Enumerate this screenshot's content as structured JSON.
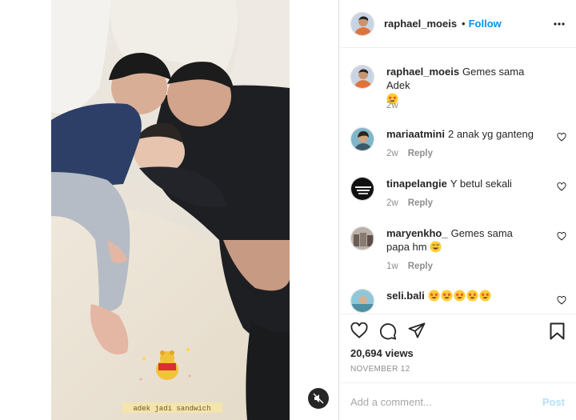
{
  "post": {
    "author": "raphael_moeis",
    "separator": "•",
    "follow_label": "Follow",
    "more_icon": "more-horizontal-icon",
    "caption": {
      "username": "raphael_moeis",
      "text": "Gemes sama Adek",
      "emoji": "star-struck-emoji",
      "time": "2w"
    },
    "comments": [
      {
        "username": "mariaatmini",
        "text": "2 anak yg ganteng",
        "time": "2w",
        "reply_label": "Reply"
      },
      {
        "username": "tinapelangie",
        "text": "Y betul sekali",
        "time": "2w",
        "reply_label": "Reply"
      },
      {
        "username": "maryenkho_",
        "text": "Gemes sama papa hm",
        "emoji": "grinning-sweat-emoji",
        "time": "1w",
        "reply_label": "Reply"
      },
      {
        "username": "seli.bali",
        "emoji_count": 5,
        "emoji": "star-struck-emoji"
      }
    ],
    "views": "20,694 views",
    "date": "NOVEMBER 12",
    "comment_placeholder": "Add a comment...",
    "post_label": "Post",
    "video_overlay_text": "adek jadi sandwich"
  },
  "colors": {
    "accent": "#0095f6",
    "post_disabled": "#b2dffc",
    "muted": "#8e8e8e"
  }
}
